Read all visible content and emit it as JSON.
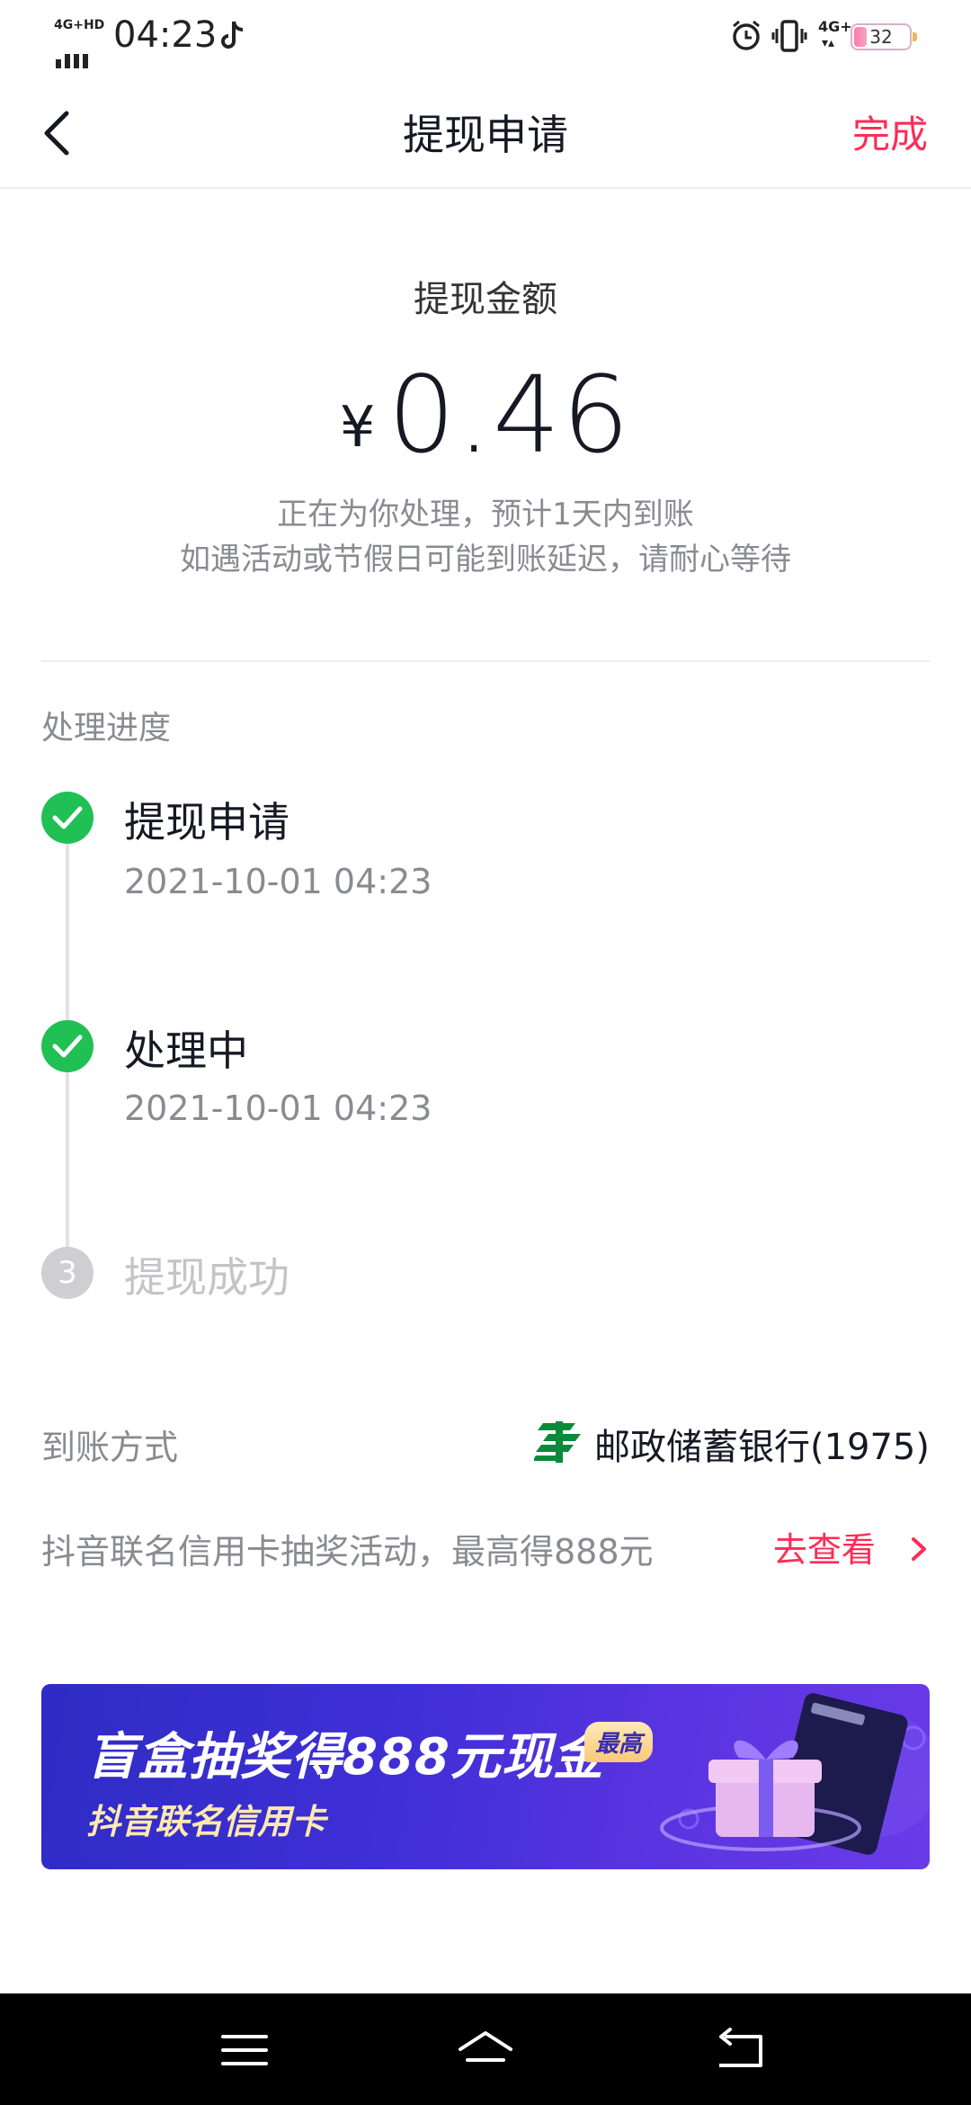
{
  "status_bar": {
    "network_label": "4G+HD",
    "time": "04:23",
    "network_right": "4G+",
    "battery": "32"
  },
  "nav": {
    "title": "提现申请",
    "done_label": "完成"
  },
  "amount": {
    "label": "提现金额",
    "currency": "¥",
    "value": "0.46",
    "note_line1": "正在为你处理，预计1天内到账",
    "note_line2": "如遇活动或节假日可能到账延迟，请耐心等待"
  },
  "progress": {
    "title": "处理进度",
    "steps": [
      {
        "title": "提现申请",
        "time": "2021-10-01 04:23",
        "status": "done"
      },
      {
        "title": "处理中",
        "time": "2021-10-01 04:23",
        "status": "done"
      },
      {
        "title": "提现成功",
        "number": "3",
        "status": "pending"
      }
    ]
  },
  "arrival": {
    "label": "到账方式",
    "bank": "邮政储蓄银行(1975)",
    "bank_icon": "postal-bank-logo-icon"
  },
  "promo": {
    "text": "抖音联名信用卡抽奖活动，最高得888元",
    "link_label": "去查看"
  },
  "banner": {
    "headline": "盲盒抽奖得888元现金",
    "tag": "最高",
    "subline": "抖音联名信用卡"
  },
  "colors": {
    "accent": "#fe2c55",
    "success": "#20c054",
    "banner_start": "#2e2cc4",
    "banner_end": "#6a3be8"
  }
}
